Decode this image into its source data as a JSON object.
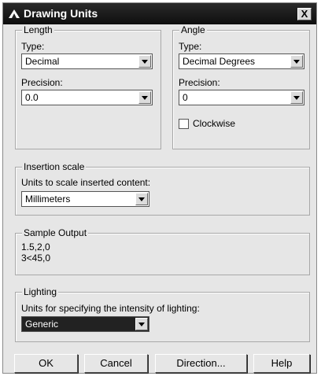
{
  "window": {
    "title": "Drawing Units",
    "close_label": "X"
  },
  "length": {
    "legend": "Length",
    "type_label": "Type:",
    "type_value": "Decimal",
    "precision_label": "Precision:",
    "precision_value": "0.0"
  },
  "angle": {
    "legend": "Angle",
    "type_label": "Type:",
    "type_value": "Decimal Degrees",
    "precision_label": "Precision:",
    "precision_value": "0",
    "clockwise_label": "Clockwise",
    "clockwise_checked": false
  },
  "insertion": {
    "legend": "Insertion scale",
    "units_label": "Units to scale inserted content:",
    "units_value": "Millimeters"
  },
  "sample": {
    "legend": "Sample Output",
    "line1": "1.5,2,0",
    "line2": "3<45,0"
  },
  "lighting": {
    "legend": "Lighting",
    "units_label": "Units for specifying the intensity of lighting:",
    "units_value": "Generic"
  },
  "buttons": {
    "ok": "OK",
    "cancel": "Cancel",
    "direction": "Direction...",
    "help": "Help"
  }
}
